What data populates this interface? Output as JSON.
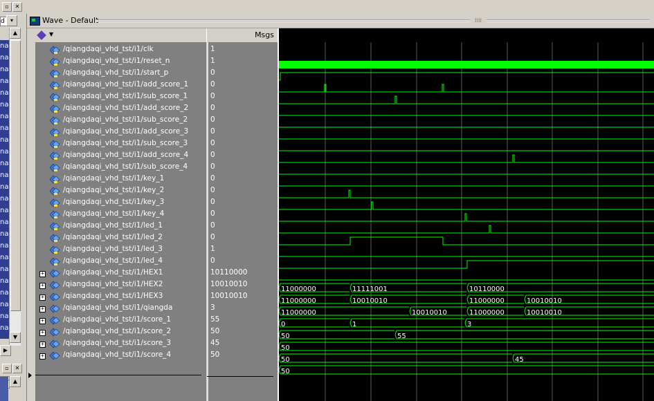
{
  "window": {
    "title": "Wave - Default",
    "msgs_header": "Msgs"
  },
  "left_panel": {
    "top_controls": "d",
    "list_items": [
      "nal",
      "nal",
      "nal",
      "nal",
      "nal",
      "nal",
      "nal",
      "nal",
      "nal",
      "nal",
      "nal",
      "nal",
      "nal",
      "nal",
      "nal",
      "nal",
      "nal",
      "nal",
      "nal",
      "nal",
      "nal",
      "nal",
      "nal",
      "nal",
      "nal"
    ],
    "bottom_item": "Or"
  },
  "signals": [
    {
      "name": "/qiangdaqi_vhd_tst/i1/clk",
      "value": "1",
      "bus": false
    },
    {
      "name": "/qiangdaqi_vhd_tst/i1/reset_n",
      "value": "1",
      "bus": false
    },
    {
      "name": "/qiangdaqi_vhd_tst/i1/start_p",
      "value": "0",
      "bus": false
    },
    {
      "name": "/qiangdaqi_vhd_tst/i1/add_score_1",
      "value": "0",
      "bus": false
    },
    {
      "name": "/qiangdaqi_vhd_tst/i1/sub_score_1",
      "value": "0",
      "bus": false
    },
    {
      "name": "/qiangdaqi_vhd_tst/i1/add_score_2",
      "value": "0",
      "bus": false
    },
    {
      "name": "/qiangdaqi_vhd_tst/i1/sub_score_2",
      "value": "0",
      "bus": false
    },
    {
      "name": "/qiangdaqi_vhd_tst/i1/add_score_3",
      "value": "0",
      "bus": false
    },
    {
      "name": "/qiangdaqi_vhd_tst/i1/sub_score_3",
      "value": "0",
      "bus": false
    },
    {
      "name": "/qiangdaqi_vhd_tst/i1/add_score_4",
      "value": "0",
      "bus": false
    },
    {
      "name": "/qiangdaqi_vhd_tst/i1/sub_score_4",
      "value": "0",
      "bus": false
    },
    {
      "name": "/qiangdaqi_vhd_tst/i1/key_1",
      "value": "0",
      "bus": false
    },
    {
      "name": "/qiangdaqi_vhd_tst/i1/key_2",
      "value": "0",
      "bus": false
    },
    {
      "name": "/qiangdaqi_vhd_tst/i1/key_3",
      "value": "0",
      "bus": false
    },
    {
      "name": "/qiangdaqi_vhd_tst/i1/key_4",
      "value": "0",
      "bus": false
    },
    {
      "name": "/qiangdaqi_vhd_tst/i1/led_1",
      "value": "0",
      "bus": false
    },
    {
      "name": "/qiangdaqi_vhd_tst/i1/led_2",
      "value": "0",
      "bus": false
    },
    {
      "name": "/qiangdaqi_vhd_tst/i1/led_3",
      "value": "1",
      "bus": false
    },
    {
      "name": "/qiangdaqi_vhd_tst/i1/led_4",
      "value": "0",
      "bus": false
    },
    {
      "name": "/qiangdaqi_vhd_tst/i1/HEX1",
      "value": "10110000",
      "bus": true
    },
    {
      "name": "/qiangdaqi_vhd_tst/i1/HEX2",
      "value": "10010010",
      "bus": true
    },
    {
      "name": "/qiangdaqi_vhd_tst/i1/HEX3",
      "value": "10010010",
      "bus": true
    },
    {
      "name": "/qiangdaqi_vhd_tst/i1/qiangda",
      "value": "3",
      "bus": true
    },
    {
      "name": "/qiangdaqi_vhd_tst/i1/score_1",
      "value": "55",
      "bus": true
    },
    {
      "name": "/qiangdaqi_vhd_tst/i1/score_2",
      "value": "50",
      "bus": true
    },
    {
      "name": "/qiangdaqi_vhd_tst/i1/score_3",
      "value": "45",
      "bus": true
    },
    {
      "name": "/qiangdaqi_vhd_tst/i1/score_4",
      "value": "50",
      "bus": true
    }
  ],
  "colors": {
    "wave": "#00ff00",
    "background": "#000000",
    "grid": "#5a5a5a",
    "bus_text": "#ffffff"
  }
}
